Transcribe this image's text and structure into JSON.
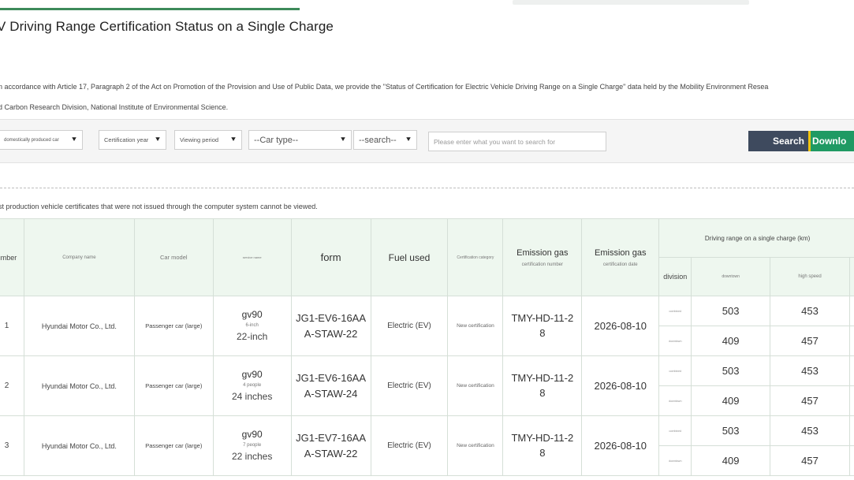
{
  "page": {
    "title": "V Driving Range Certification Status on a Single Charge",
    "intro_line1": "n accordance with Article 17, Paragraph 2 of the Act on Promotion of the Provision and Use of Public Data, we provide the \"Status of Certification for Electric Vehicle Driving Range on a Single Charge\" data held by the Mobility Environment Resea",
    "intro_line2": "d Carbon Research Division, National Institute of Environmental Science.",
    "notice": "st production vehicle certificates that were not issued through the computer system cannot be viewed."
  },
  "filters": {
    "origin": "domestically produced car",
    "cert_year": "Certification year",
    "view_period": "Viewing period",
    "car_type": "--Car type--",
    "search_field": "--search--",
    "search_placeholder": "Please enter what you want to search for",
    "search_button": "Search",
    "download_button": "Downlo"
  },
  "icons": {
    "dropdown": "chevron-down-icon"
  },
  "colors": {
    "header_bg": "#eef7ef",
    "search_btn": "#3e4a5e",
    "download_btn": "#1f9a63",
    "accent_line": "#3d8a5a"
  },
  "table": {
    "headers": {
      "number": "umber",
      "company": "Company name",
      "car_model": "Car model",
      "service_name": "service name",
      "form": "form",
      "fuel": "Fuel used",
      "cert_category": "Certification category",
      "emission_number_top": "Emission gas",
      "emission_number_bottom": "certification number",
      "emission_date_top": "Emission gas",
      "emission_date_bottom": "certification date",
      "range_group": "Driving range on a single charge (km)",
      "division": "division",
      "downtown": "downtown",
      "highspeed": "high speed"
    },
    "rows": [
      {
        "number": "1",
        "company": "Hyundai Motor Co., Ltd.",
        "car_type": "Passenger car (large)",
        "model_name": "gv90",
        "model_sub": "6-inch",
        "model_size": "22-inch",
        "form_line1": "JG1-EV6-16AA",
        "form_line2": "A-STAW-22",
        "fuel": "Electric (EV)",
        "category": "New certification",
        "cert_no_line1": "TMY-HD-11-2",
        "cert_no_line2": "8",
        "cert_date": "2026-08-10",
        "div_a": "combined",
        "div_b": "downtown",
        "range_a_city": "503",
        "range_a_hwy": "453",
        "range_b_city": "409",
        "range_b_hwy": "457"
      },
      {
        "number": "2",
        "company": "Hyundai Motor Co., Ltd.",
        "car_type": "Passenger car (large)",
        "model_name": "gv90",
        "model_sub": "4 people",
        "model_size": "24 inches",
        "form_line1": "JG1-EV6-16AA",
        "form_line2": "A-STAW-24",
        "fuel": "Electric (EV)",
        "category": "New certification",
        "cert_no_line1": "TMY-HD-11-2",
        "cert_no_line2": "8",
        "cert_date": "2026-08-10",
        "div_a": "combined",
        "div_b": "downtown",
        "range_a_city": "503",
        "range_a_hwy": "453",
        "range_b_city": "409",
        "range_b_hwy": "457"
      },
      {
        "number": "3",
        "company": "Hyundai Motor Co., Ltd.",
        "car_type": "Passenger car (large)",
        "model_name": "gv90",
        "model_sub": "7 people",
        "model_size": "22 inches",
        "form_line1": "JG1-EV7-16AA",
        "form_line2": "A-STAW-22",
        "fuel": "Electric (EV)",
        "category": "New certification",
        "cert_no_line1": "TMY-HD-11-2",
        "cert_no_line2": "8",
        "cert_date": "2026-08-10",
        "div_a": "combined",
        "div_b": "downtown",
        "range_a_city": "503",
        "range_a_hwy": "453",
        "range_b_city": "409",
        "range_b_hwy": "457"
      }
    ]
  }
}
